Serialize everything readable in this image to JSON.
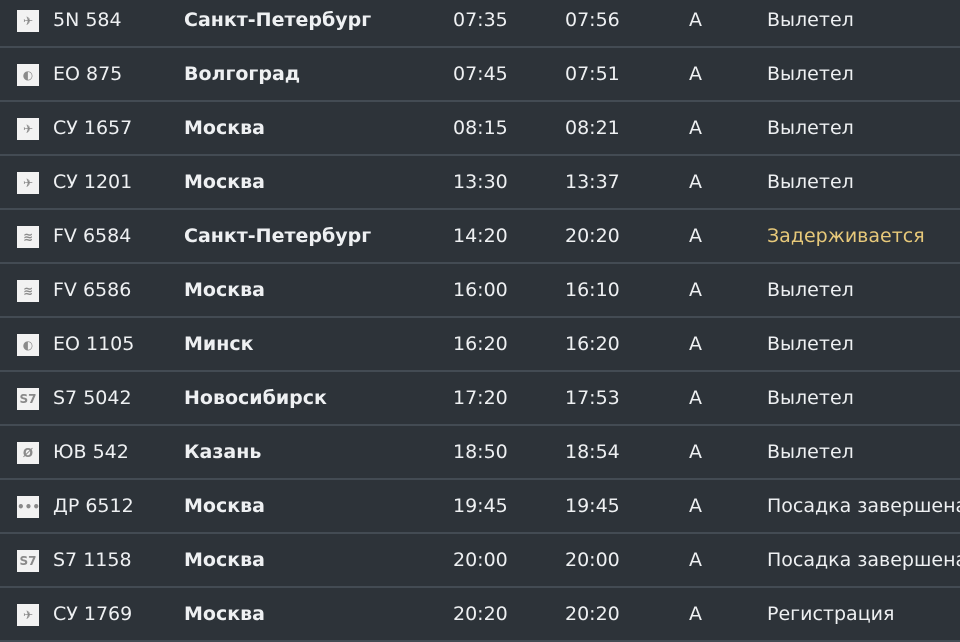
{
  "colors": {
    "background": "#2d3339",
    "separator": "#434b53",
    "text": "#eef0f2",
    "delayed": "#e7c97a"
  },
  "flights": [
    {
      "logo": "rossiya-plane-icon",
      "logo_glyph": "✈",
      "flight": "5N 584",
      "city": "Санкт-Петербург",
      "scheduled": "07:35",
      "actual": "07:56",
      "terminal": "A",
      "status": "Вылетел",
      "delayed": false
    },
    {
      "logo": "pobeda-logo-icon",
      "logo_glyph": "◐",
      "flight": "EO 875",
      "city": "Волгоград",
      "scheduled": "07:45",
      "actual": "07:51",
      "terminal": "A",
      "status": "Вылетел",
      "delayed": false
    },
    {
      "logo": "aeroflot-plane-icon",
      "logo_glyph": "✈",
      "flight": "СУ 1657",
      "city": "Москва",
      "scheduled": "08:15",
      "actual": "08:21",
      "terminal": "A",
      "status": "Вылетел",
      "delayed": false
    },
    {
      "logo": "aeroflot-plane-icon",
      "logo_glyph": "✈",
      "flight": "СУ 1201",
      "city": "Москва",
      "scheduled": "13:30",
      "actual": "13:37",
      "terminal": "A",
      "status": "Вылетел",
      "delayed": false
    },
    {
      "logo": "rossiya-swirl-icon",
      "logo_glyph": "≋",
      "flight": "FV 6584",
      "city": "Санкт-Петербург",
      "scheduled": "14:20",
      "actual": "20:20",
      "terminal": "A",
      "status": "Задерживается",
      "delayed": true
    },
    {
      "logo": "rossiya-swirl-icon",
      "logo_glyph": "≋",
      "flight": "FV 6586",
      "city": "Москва",
      "scheduled": "16:00",
      "actual": "16:10",
      "terminal": "A",
      "status": "Вылетел",
      "delayed": false
    },
    {
      "logo": "pobeda-logo-icon",
      "logo_glyph": "◐",
      "flight": "EO 1105",
      "city": "Минск",
      "scheduled": "16:20",
      "actual": "16:20",
      "terminal": "A",
      "status": "Вылетел",
      "delayed": false
    },
    {
      "logo": "s7-logo-icon",
      "logo_glyph": "S7",
      "flight": "S7 5042",
      "city": "Новосибирск",
      "scheduled": "17:20",
      "actual": "17:53",
      "terminal": "A",
      "status": "Вылетел",
      "delayed": false
    },
    {
      "logo": "utair-logo-icon",
      "logo_glyph": "Ø",
      "flight": "ЮВ 542",
      "city": "Казань",
      "scheduled": "18:50",
      "actual": "18:54",
      "terminal": "A",
      "status": "Вылетел",
      "delayed": false
    },
    {
      "logo": "dots-logo-icon",
      "logo_glyph": "•••",
      "flight": "ДР 6512",
      "city": "Москва",
      "scheduled": "19:45",
      "actual": "19:45",
      "terminal": "A",
      "status": "Посадка завершена",
      "delayed": false
    },
    {
      "logo": "s7-logo-icon",
      "logo_glyph": "S7",
      "flight": "S7 1158",
      "city": "Москва",
      "scheduled": "20:00",
      "actual": "20:00",
      "terminal": "A",
      "status": "Посадка завершена",
      "delayed": false
    },
    {
      "logo": "aeroflot-plane-icon",
      "logo_glyph": "✈",
      "flight": "СУ 1769",
      "city": "Москва",
      "scheduled": "20:20",
      "actual": "20:20",
      "terminal": "A",
      "status": "Регистрация",
      "delayed": false
    }
  ]
}
